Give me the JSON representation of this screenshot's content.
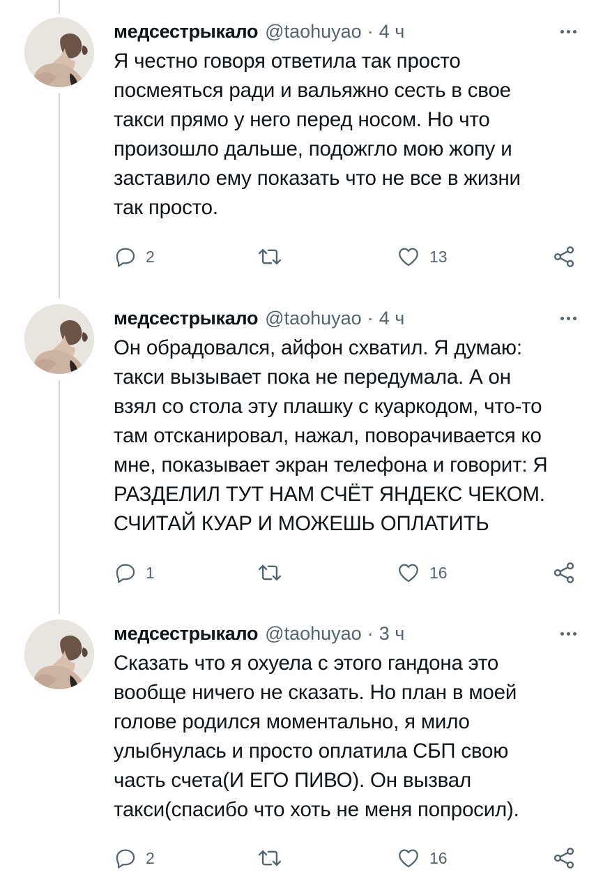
{
  "tweets": [
    {
      "author_name": "медсестрыкало",
      "handle": "@taohuyao",
      "separator": "·",
      "time": "4 ч",
      "text": "Я честно говоря ответила так просто\nпосмеяться ради и вальяжно сесть в свое\nтакси прямо у него перед носом. Но что\nпроизошло дальше, подожгло мою жопу и\nзаставило ему показать что не все в жизни\nтак просто.",
      "replies": "2",
      "likes": "13"
    },
    {
      "author_name": "медсестрыкало",
      "handle": "@taohuyao",
      "separator": "·",
      "time": "4 ч",
      "text": "Он обрадовался, айфон схватил. Я думаю:\nтакси вызывает пока не передумала. А он\nвзял со стола эту плашку с куаркодом, что-то\nтам отсканировал, нажал, поворачивается ко\nмне, показывает экран телефона и говорит: Я\nРАЗДЕЛИЛ ТУТ НАМ СЧЁТ ЯНДЕКС ЧЕКОМ.\nСЧИТАЙ КУАР И МОЖЕШЬ ОПЛАТИТЬ",
      "replies": "1",
      "likes": "16"
    },
    {
      "author_name": "медсестрыкало",
      "handle": "@taohuyao",
      "separator": "·",
      "time": "3 ч",
      "text": "Сказать что я охуела с этого гандона это\nвообще ничего не сказать. Но план в моей\nголове родился моментально, я мило\nулыбнулась и просто оплатила СБП свою\nчасть счета(И ЕГО ПИВО). Он вызвал\nтакси(спасибо что хоть не меня попросил).",
      "replies": "2",
      "likes": "16"
    }
  ],
  "icons": {
    "reply": "reply-icon",
    "retweet": "retweet-icon",
    "like": "heart-icon",
    "share": "share-icon",
    "more": "more-icon"
  },
  "colors": {
    "text": "#0f1419",
    "secondary": "#536471",
    "thread_line": "#cfd9de"
  }
}
